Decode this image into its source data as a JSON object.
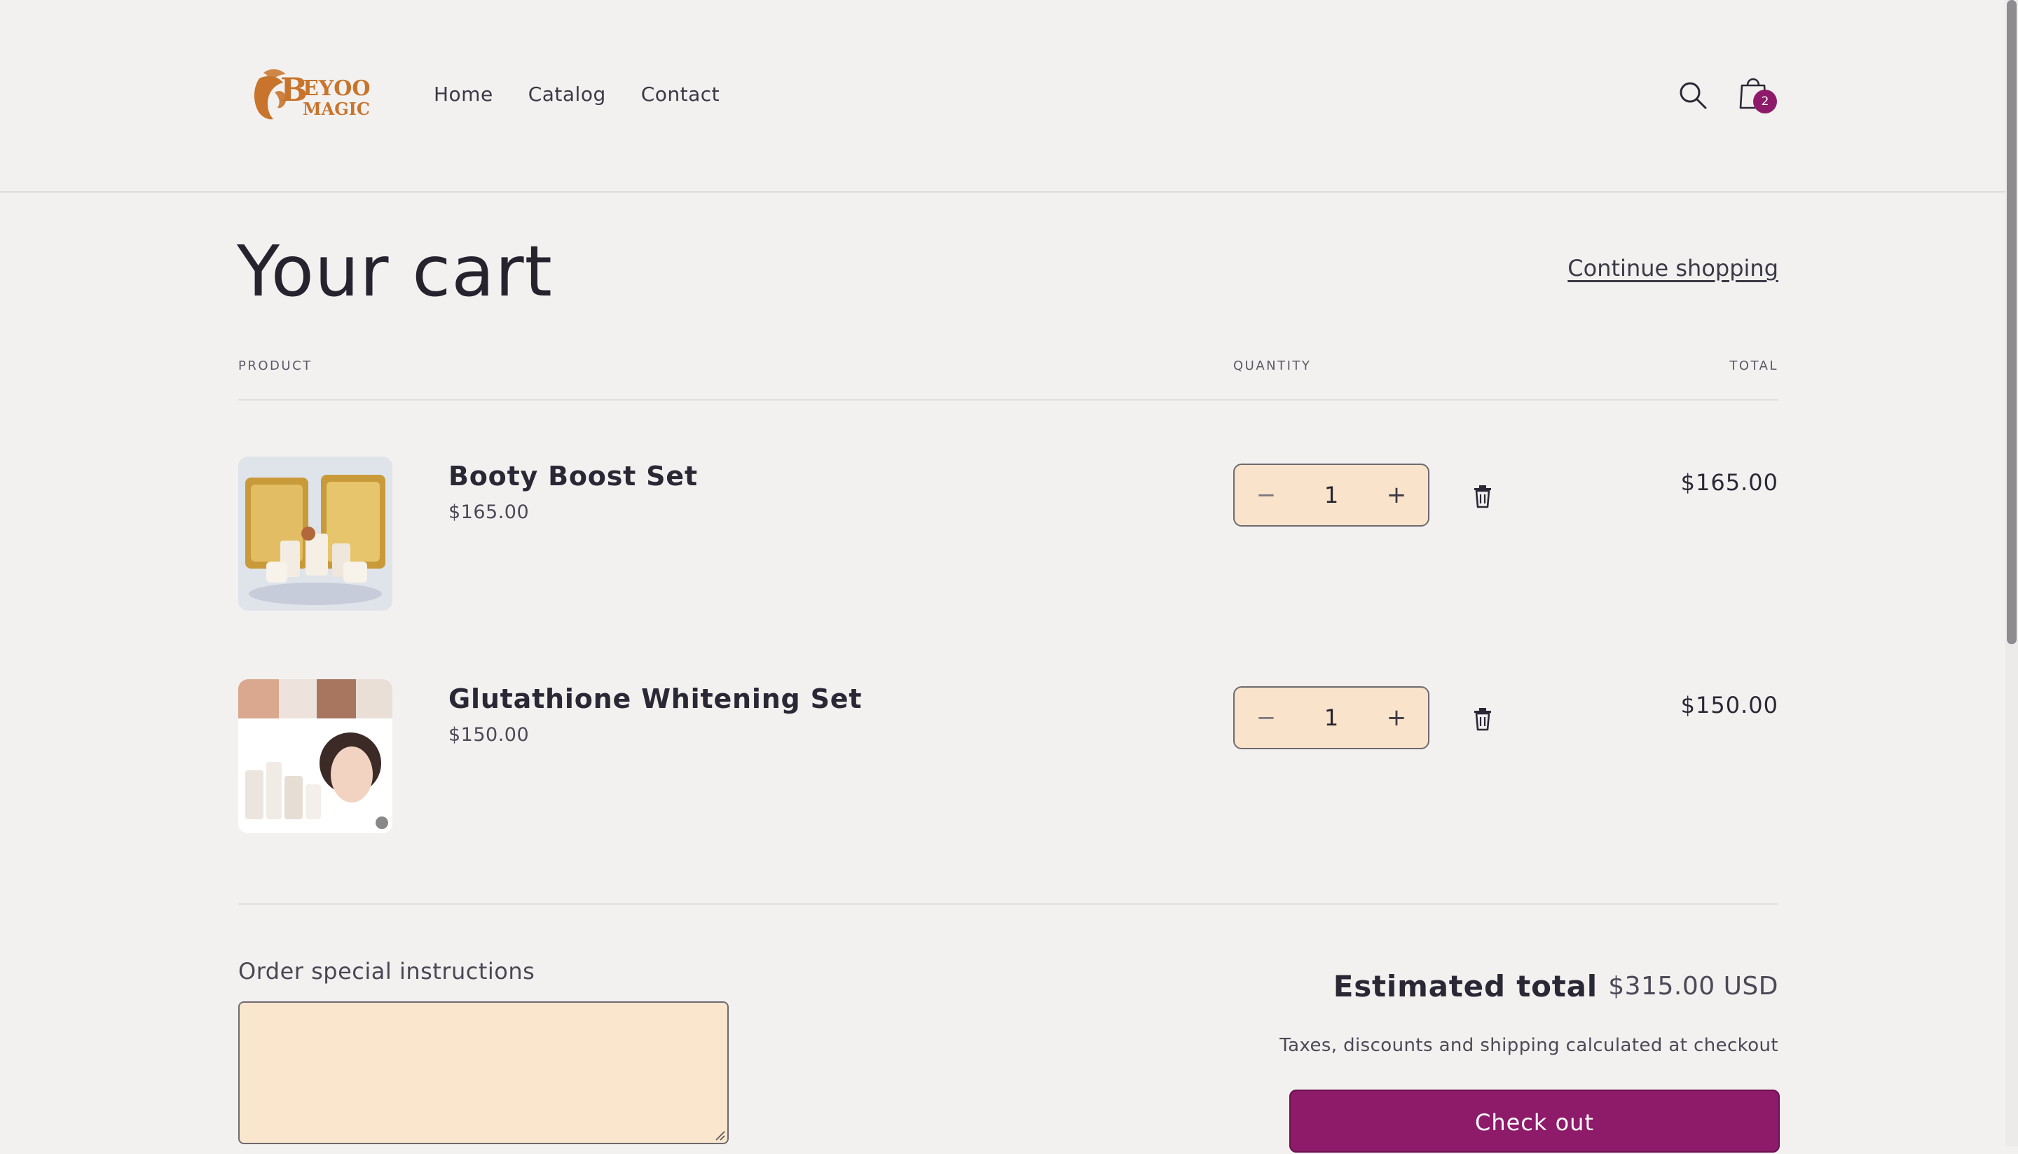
{
  "brand": {
    "logo_line1": "EYOO",
    "logo_initial": "B",
    "logo_line2": "MAGIC"
  },
  "nav": {
    "items": [
      {
        "label": "Home"
      },
      {
        "label": "Catalog"
      },
      {
        "label": "Contact"
      }
    ]
  },
  "header": {
    "search_icon": "search-icon",
    "cart_icon": "bag-icon",
    "cart_count": "2"
  },
  "cart": {
    "title": "Your cart",
    "continue_label": "Continue shopping",
    "columns": {
      "product": "PRODUCT",
      "quantity": "QUANTITY",
      "total": "TOTAL"
    },
    "items": [
      {
        "name": "Booty Boost Set",
        "price": "$165.00",
        "quantity": "1",
        "line_total": "$165.00",
        "minus": "−",
        "plus": "+"
      },
      {
        "name": "Glutathione Whitening Set",
        "price": "$150.00",
        "quantity": "1",
        "line_total": "$150.00",
        "minus": "−",
        "plus": "+"
      }
    ]
  },
  "summary": {
    "instructions_label": "Order special instructions",
    "instructions_value": "",
    "estimated_label": "Estimated total",
    "estimated_value": "$315.00 USD",
    "tax_note": "Taxes, discounts and shipping calculated at checkout",
    "checkout_label": "Check out"
  },
  "colors": {
    "accent": "#8e1a6a",
    "input_bg": "#f9e3ca",
    "background": "#f2f1ef",
    "text": "#26232f"
  }
}
